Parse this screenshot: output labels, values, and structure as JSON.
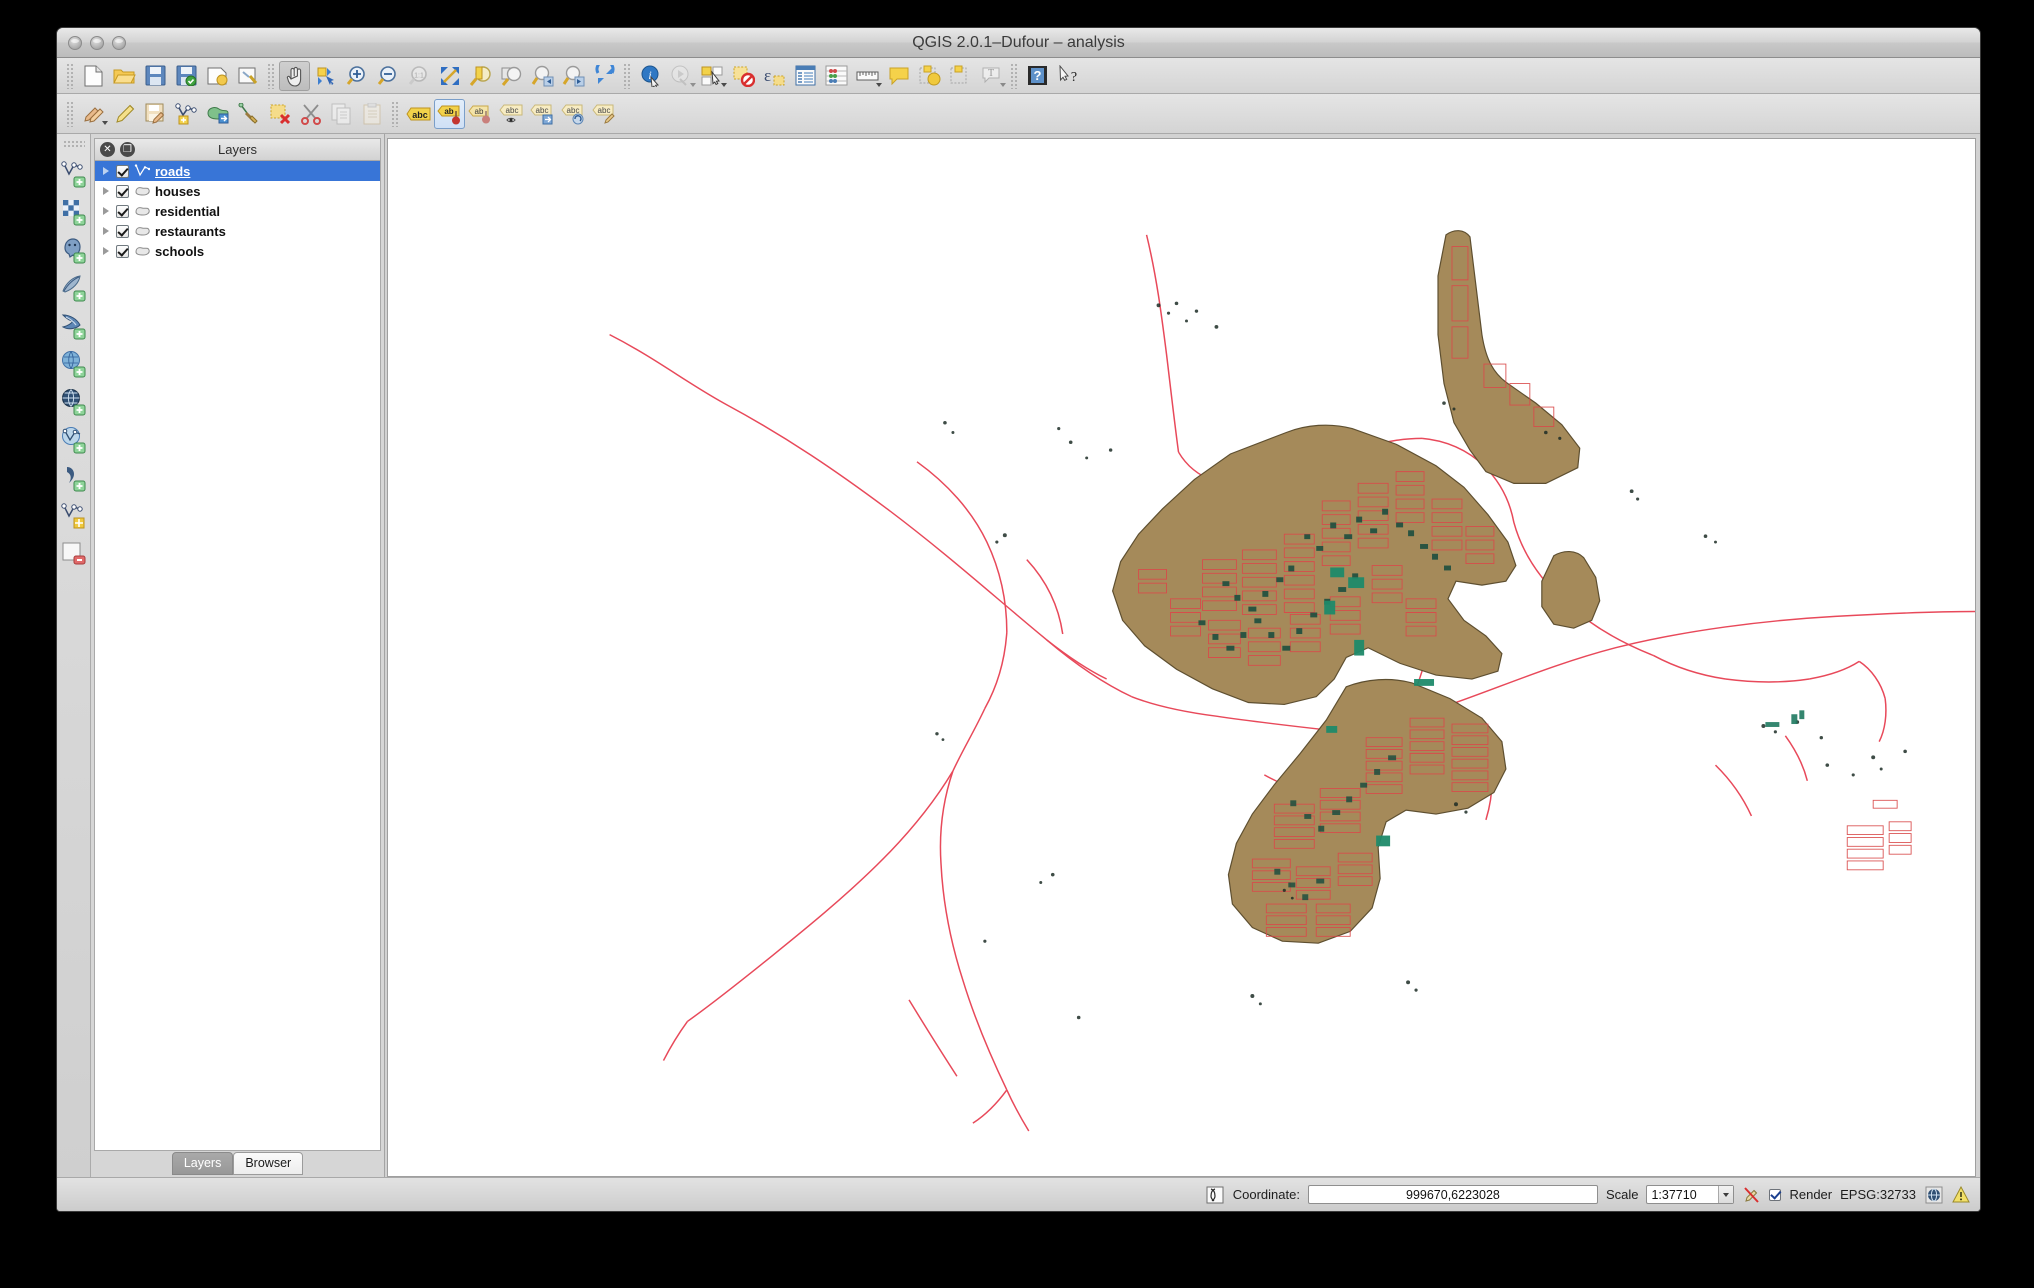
{
  "window": {
    "title": "QGIS 2.0.1–Dufour – analysis",
    "traffic_lights": [
      "close",
      "minimize",
      "zoom"
    ]
  },
  "toolbars": {
    "file_row": [
      {
        "name": "new-project-icon",
        "label": "New Project"
      },
      {
        "name": "open-project-icon",
        "label": "Open Project"
      },
      {
        "name": "save-project-icon",
        "label": "Save Project"
      },
      {
        "name": "save-project-as-icon",
        "label": "Save Project As"
      },
      {
        "name": "new-print-composer-icon",
        "label": "New Print Composer"
      },
      {
        "name": "composer-manager-icon",
        "label": "Composer Manager"
      },
      {
        "name": "pan-map-icon",
        "label": "Pan Map",
        "active": true
      },
      {
        "name": "pan-to-selection-icon",
        "label": "Pan Map to Selection"
      },
      {
        "name": "zoom-in-icon",
        "label": "Zoom In"
      },
      {
        "name": "zoom-out-icon",
        "label": "Zoom Out"
      },
      {
        "name": "zoom-native-icon",
        "label": "Zoom to Native Resolution (1:1)"
      },
      {
        "name": "zoom-full-icon",
        "label": "Zoom Full"
      },
      {
        "name": "zoom-to-selection-icon",
        "label": "Zoom to Selection"
      },
      {
        "name": "zoom-to-layer-icon",
        "label": "Zoom to Layer"
      },
      {
        "name": "zoom-last-icon",
        "label": "Zoom Last"
      },
      {
        "name": "zoom-next-icon",
        "label": "Zoom Next"
      },
      {
        "name": "refresh-icon",
        "label": "Refresh"
      },
      {
        "name": "identify-features-icon",
        "label": "Identify Features"
      },
      {
        "name": "map-tips-icon",
        "label": "Map Tips"
      },
      {
        "name": "select-features-icon",
        "label": "Select Features by Area"
      },
      {
        "name": "deselect-features-icon",
        "label": "Deselect Features from All Layers"
      },
      {
        "name": "select-by-expression-icon",
        "label": "Select Features using an Expression"
      },
      {
        "name": "open-attribute-table-icon",
        "label": "Open Attribute Table"
      },
      {
        "name": "statistics-icon",
        "label": "Show Statistical Summary"
      },
      {
        "name": "measure-line-icon",
        "label": "Measure Line"
      },
      {
        "name": "map-annotation-icon",
        "label": "Text Annotation"
      },
      {
        "name": "new-bookmark-icon",
        "label": "New Bookmark"
      },
      {
        "name": "show-bookmarks-icon",
        "label": "Show Bookmarks"
      },
      {
        "name": "text-annotation-icon",
        "label": "Annotation"
      },
      {
        "name": "help-contents-icon",
        "label": "Help Contents"
      },
      {
        "name": "whats-this-icon",
        "label": "What's This?"
      }
    ],
    "digitize_row": [
      {
        "name": "current-edits-icon",
        "label": "Current Edits"
      },
      {
        "name": "toggle-editing-icon",
        "label": "Toggle Editing"
      },
      {
        "name": "save-layer-edits-icon",
        "label": "Save Layer Edits"
      },
      {
        "name": "add-feature-icon",
        "label": "Add Feature"
      },
      {
        "name": "move-feature-icon",
        "label": "Move Feature"
      },
      {
        "name": "node-tool-icon",
        "label": "Node Tool"
      },
      {
        "name": "delete-selected-icon",
        "label": "Delete Selected"
      },
      {
        "name": "cut-features-icon",
        "label": "Cut Features"
      },
      {
        "name": "copy-features-icon",
        "label": "Copy Features"
      },
      {
        "name": "paste-features-icon",
        "label": "Paste Features"
      },
      {
        "name": "layer-labeling-icon",
        "label": "Layer Labeling Options"
      },
      {
        "name": "pin-labels-icon",
        "label": "Pin/Unpin Labels",
        "selected": true
      },
      {
        "name": "show-hide-labels-icon",
        "label": "Show/Hide Labels"
      },
      {
        "name": "highlight-pinned-labels-icon",
        "label": "Highlight Pinned Labels"
      },
      {
        "name": "move-label-icon",
        "label": "Move Label"
      },
      {
        "name": "rotate-label-icon",
        "label": "Rotate Label"
      },
      {
        "name": "change-label-icon",
        "label": "Change Label"
      }
    ],
    "manage_layers": [
      {
        "name": "add-vector-layer-icon",
        "label": "Add Vector Layer"
      },
      {
        "name": "add-raster-layer-icon",
        "label": "Add Raster Layer"
      },
      {
        "name": "add-postgis-layer-icon",
        "label": "Add PostGIS Layer"
      },
      {
        "name": "add-spatialite-layer-icon",
        "label": "Add SpatiaLite Layer"
      },
      {
        "name": "add-mssql-layer-icon",
        "label": "Add MSSQL Spatial Layer"
      },
      {
        "name": "add-wcs-layer-icon",
        "label": "Add WCS Layer"
      },
      {
        "name": "add-wms-layer-icon",
        "label": "Add WMS/WMTS Layer"
      },
      {
        "name": "add-wfs-layer-icon",
        "label": "Add WFS Layer"
      },
      {
        "name": "add-delimited-text-layer-icon",
        "label": "Add Delimited Text Layer"
      },
      {
        "name": "new-vector-layer-icon",
        "label": "New Vector Layer"
      },
      {
        "name": "remove-layer-icon",
        "label": "Remove Layer"
      }
    ]
  },
  "panel": {
    "title": "Layers",
    "close_glyph": "✕",
    "undock_glyph": "❐",
    "layers": [
      {
        "name": "roads",
        "geometry": "line",
        "checked": true,
        "selected": true
      },
      {
        "name": "houses",
        "geometry": "polygon",
        "checked": true,
        "selected": false
      },
      {
        "name": "residential",
        "geometry": "polygon",
        "checked": true,
        "selected": false
      },
      {
        "name": "restaurants",
        "geometry": "polygon",
        "checked": true,
        "selected": false
      },
      {
        "name": "schools",
        "geometry": "polygon",
        "checked": true,
        "selected": false
      }
    ],
    "tabs": [
      {
        "label": "Layers",
        "selected": true
      },
      {
        "label": "Browser",
        "selected": false
      }
    ]
  },
  "statusbar": {
    "coordinate_label": "Coordinate:",
    "coordinate_value": "999670,6223028",
    "scale_label": "Scale",
    "scale_value": "1:37710",
    "render_label": "Render",
    "render_checked": true,
    "crs": "EPSG:32733",
    "icons": [
      "messages-icon",
      "render-toggle-icon",
      "crs-status-icon",
      "warning-icon"
    ]
  },
  "map": {
    "colors": {
      "residential_fill": "#a58a5a",
      "residential_stroke": "#6b5a37",
      "roads": "#e8495a",
      "buildings": "#1d4f3f",
      "houses_outline": "#d94a4a",
      "background": "#ffffff",
      "selection": "#3875d7"
    }
  }
}
